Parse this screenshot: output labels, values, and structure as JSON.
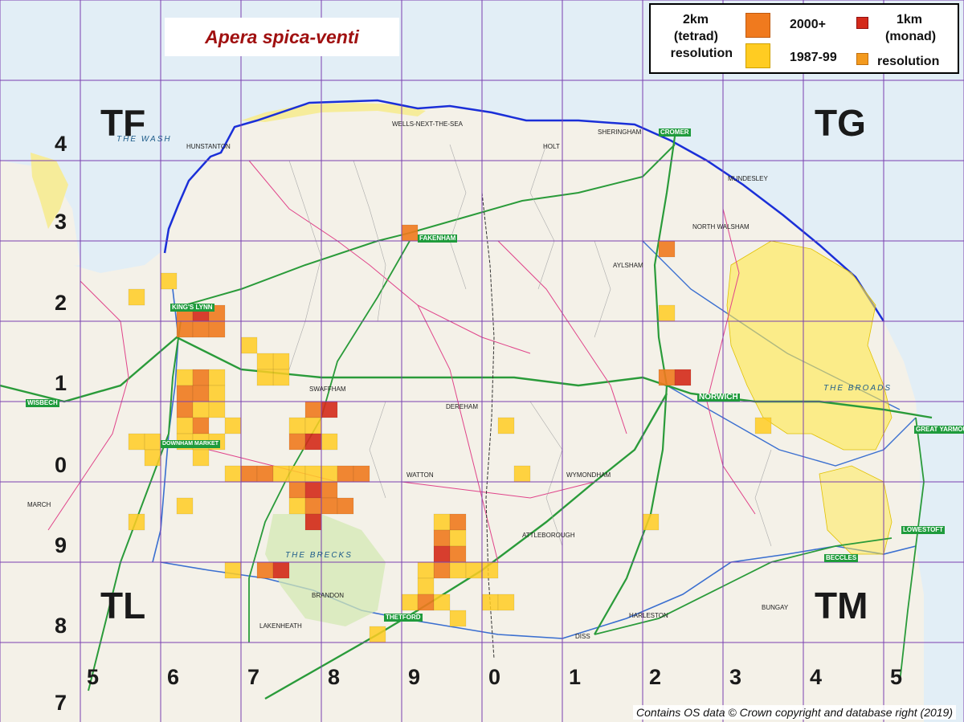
{
  "map": {
    "title": "Apera spica-venti",
    "attribution": "Contains OS data © Crown copyright and database right (2019)",
    "region_labels": [
      "TF",
      "TG",
      "TL",
      "TM"
    ],
    "row_labels": [
      "4",
      "3",
      "2",
      "1",
      "0",
      "9",
      "8",
      "7"
    ],
    "column_labels": [
      "5",
      "6",
      "7",
      "8",
      "9",
      "0",
      "1",
      "2",
      "3",
      "4",
      "5"
    ],
    "legend": {
      "tetrad_label_line1": "2km",
      "tetrad_label_line2": "(tetrad)",
      "tetrad_label_line3": "resolution",
      "monad_label_line1": "1km",
      "monad_label_line2": "(monad)",
      "monad_label_line3": "resolution",
      "recent_label": "2000+",
      "old_label": "1987-99"
    },
    "colors": {
      "recent_tetrad": "#f07a1e",
      "old_tetrad": "#ffcc22",
      "monad_recent": "#d42a1a",
      "monad_old": "#f39a1e",
      "sea": "#e2eef6",
      "land": "#f4f1e8",
      "coast": "#1a2fd8",
      "grid": "#7a3fb0"
    },
    "places": [
      "HUNSTANTON",
      "FAKENHAM",
      "CROMER",
      "NORWICH",
      "GREAT YARMOUTH",
      "LOWESTOFT",
      "BECCLES",
      "DEREHAM",
      "THETFORD",
      "KING'S LYNN",
      "DOWNHAM MARKET",
      "WISBECH",
      "BRANDON",
      "WATTON",
      "ATTLEBOROUGH",
      "WYMONDHAM",
      "AYLSHAM",
      "NORTH WALSHAM",
      "BUNGAY",
      "HARLESTON",
      "DISS",
      "MARCH",
      "LAKENHEATH",
      "SWAFFHAM",
      "HOLT",
      "WELLS-NEXT-THE-SEA",
      "SHERINGHAM",
      "MUNDESLEY"
    ],
    "area_names": [
      "THE WASH",
      "THE BRECKS",
      "THE BROADS"
    ]
  }
}
